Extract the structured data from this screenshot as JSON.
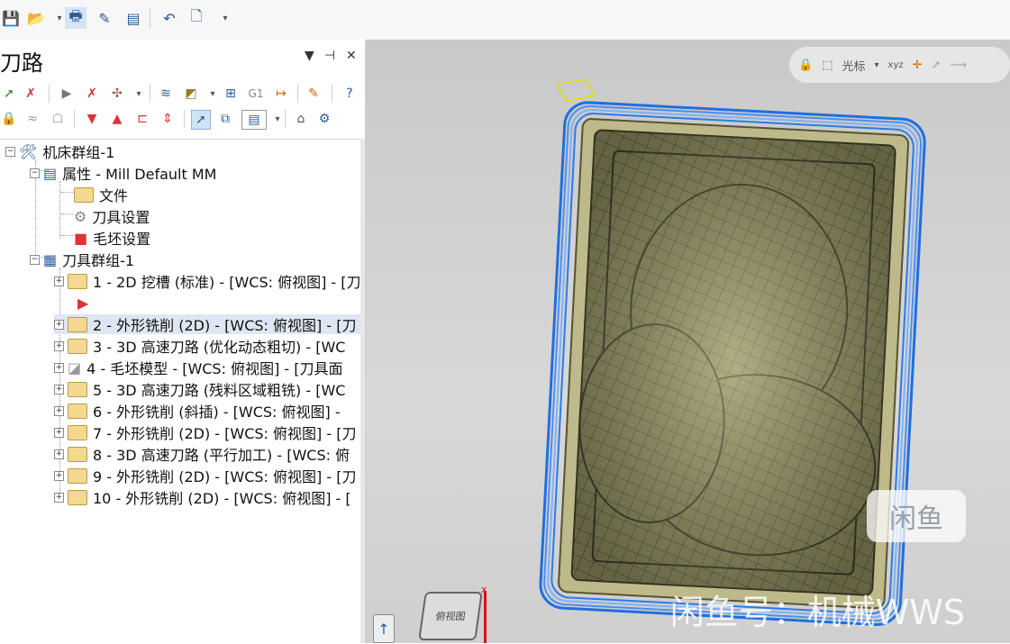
{
  "toolbar": {
    "icons": [
      "save-icon",
      "open-folder-icon",
      "print-icon",
      "edit-icon",
      "book-icon",
      "undo-icon",
      "new-file-icon",
      "more-icon"
    ]
  },
  "panel": {
    "title": "刀路",
    "controls": {
      "dropdown": "▼",
      "pin": "📌",
      "close": "✕"
    }
  },
  "tree": {
    "root": "机床群组-1",
    "properties": "属性 - Mill Default MM",
    "files": "文件",
    "tool_settings": "刀具设置",
    "stock_settings": "毛坯设置",
    "tool_group": "刀具群组-1",
    "ops": [
      "1 - 2D 挖槽 (标准) - [WCS: 俯视图] - [刀",
      "2 - 外形铣削 (2D) - [WCS: 俯视图] - [刀",
      "3 - 3D 高速刀路 (优化动态粗切) - [WC",
      "4 - 毛坯模型 - [WCS: 俯视图] - [刀具面",
      "5 - 3D 高速刀路 (残料区域粗铣) - [WC",
      "6 - 外形铣削 (斜插) - [WCS: 俯视图] -",
      "7 - 外形铣削 (2D) - [WCS: 俯视图] - [刀",
      "8 - 3D 高速刀路 (平行加工) - [WCS: 俯",
      "9 - 外形铣削 (2D) - [WCS: 俯视图] - [刀",
      "10 - 外形铣削 (2D) - [WCS: 俯视图] - ["
    ]
  },
  "viewport": {
    "cursor_label": "光标",
    "watermark": "闲鱼号：机械WWS",
    "logo_text": "闲鱼",
    "viewcube_label": "俯视图",
    "axis_x": "x"
  }
}
